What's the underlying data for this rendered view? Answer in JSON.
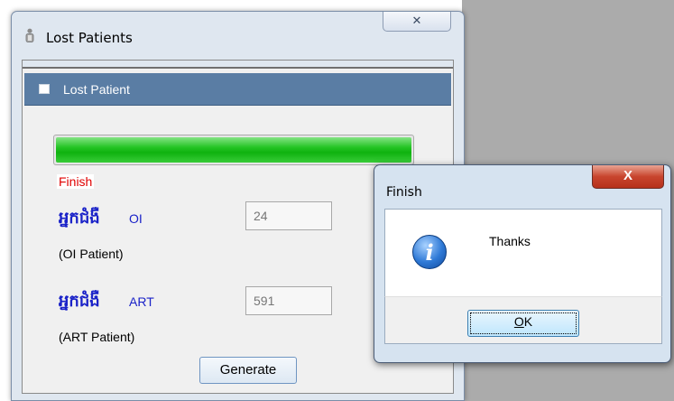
{
  "window": {
    "title": "Lost Patients",
    "close_glyph": "✕",
    "app_icon": "person-icon"
  },
  "header": {
    "label": "Lost Patient",
    "icon": "document-icon"
  },
  "progress": {
    "percent": 100,
    "color": "#1fbe1f"
  },
  "status": {
    "text": "Finish",
    "color": "#e00000"
  },
  "fields": {
    "oi": {
      "khmer_label": "អ្នកជំងឺ",
      "code": "OI",
      "english": "(OI Patient)",
      "value": "24"
    },
    "art": {
      "khmer_label": "អ្នកជំងឺ",
      "code": "ART",
      "english": "(ART Patient)",
      "value": "591"
    }
  },
  "buttons": {
    "generate": "Generate"
  },
  "dialog": {
    "title": "Finish",
    "close_glyph": "X",
    "message": "Thanks",
    "icon": "info-icon",
    "ok_mnemonic": "O",
    "ok_rest": "K"
  }
}
